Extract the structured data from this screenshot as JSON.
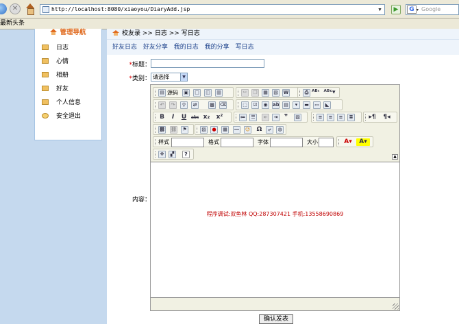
{
  "browser": {
    "address": "http://localhost:8080/xiaoyou/DiaryAdd.jsp",
    "search_placeholder": "Google",
    "bookmark": "最新头条"
  },
  "sidebar": {
    "title": "管理导航",
    "items": [
      {
        "label": "日志",
        "icon": "book-icon"
      },
      {
        "label": "心情",
        "icon": "book-icon"
      },
      {
        "label": "相册",
        "icon": "book-icon"
      },
      {
        "label": "好友",
        "icon": "book-icon"
      },
      {
        "label": "个人信息",
        "icon": "book-icon"
      },
      {
        "label": "安全退出",
        "icon": "exit-icon"
      }
    ]
  },
  "breadcrumb": {
    "items": [
      "校友录",
      "日志",
      "写日志"
    ],
    "separator": ">>"
  },
  "subnav": {
    "links": [
      "好友日志",
      "好友分享",
      "我的日志",
      "我的分享",
      "写日志"
    ]
  },
  "form": {
    "required_mark": "*",
    "title_label": "标题：",
    "title_value": "",
    "category_label": "类别：",
    "category_selected": "请选择",
    "content_label": "内容："
  },
  "editor": {
    "source_label": "源码",
    "style_label": "样式",
    "format_label": "格式",
    "font_label": "字体",
    "size_label": "大小",
    "content_text": "程序调试:双鱼林 QQ:287307421 手机:13558690869"
  },
  "submit": {
    "label": "确认发表"
  }
}
